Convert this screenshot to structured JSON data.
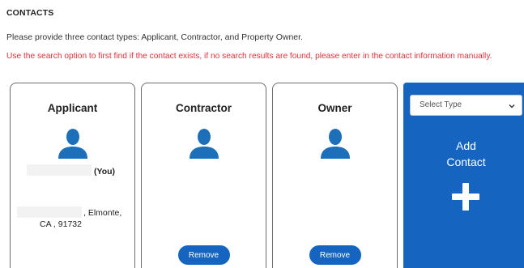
{
  "section_title": "CONTACTS",
  "instructions": "Please provide three contact types: Applicant, Contractor, and Property Owner.",
  "warning": "Use the search option to first find if the contact exists, if no search results are found, please enter in the contact information manually.",
  "cards": [
    {
      "title": "Applicant",
      "you_label": "(You)",
      "address_line1": ", Elmonte,",
      "address_line2": "CA , 91732",
      "icon": "person-avatar-icon"
    },
    {
      "title": "Contractor",
      "remove_label": "Remove",
      "icon": "person-avatar-icon"
    },
    {
      "title": "Owner",
      "remove_label": "Remove",
      "icon": "person-avatar-icon"
    }
  ],
  "add_contact": {
    "select_placeholder": "Select Type",
    "label_line1": "Add",
    "label_line2": "Contact",
    "icon": "plus-icon"
  },
  "colors": {
    "accent": "#1565c0",
    "warning": "#e0303a",
    "avatar": "#1c6fb8"
  }
}
